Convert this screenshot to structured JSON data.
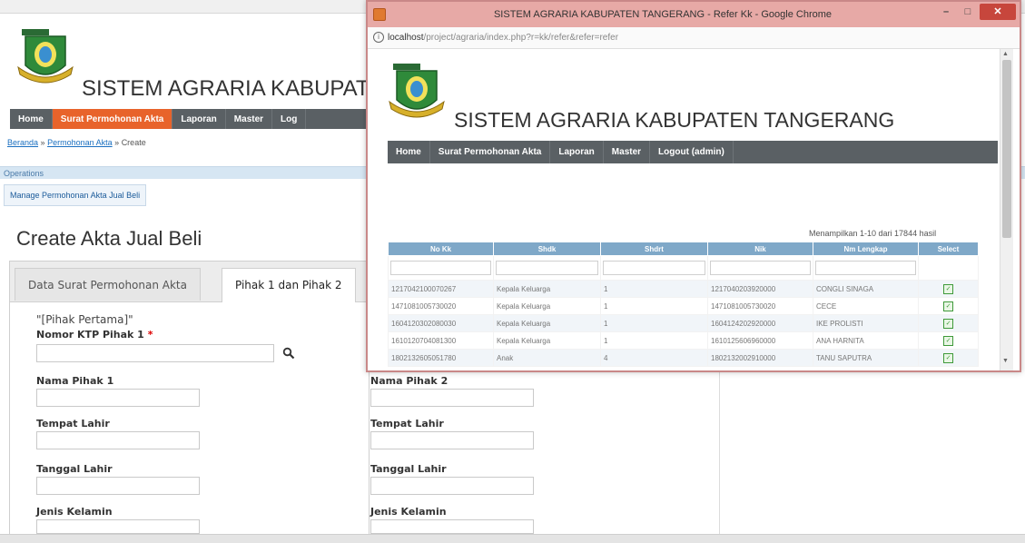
{
  "main": {
    "site_title": "SISTEM AGRARIA KABUPAT",
    "nav": [
      "Home",
      "Surat Permohonan Akta",
      "Laporan",
      "Master",
      "Log"
    ],
    "breadcrumb": {
      "home": "Beranda",
      "sep1": "»",
      "parent": "Permohonan Akta",
      "sep2": "»",
      "current": "Create"
    },
    "operations_label": "Operations",
    "manage_link": "Manage Permohonan Akta Jual Beli",
    "heading": "Create Akta Jual Beli",
    "tabs": [
      "Data Surat Permohonan Akta",
      "Pihak 1 dan Pihak 2"
    ],
    "form": {
      "pihak_pertama_note": "\"[Pihak Pertama]\"",
      "nomor_ktp_label": "Nomor KTP Pihak 1",
      "required_mark": "*",
      "nama_pihak_1": "Nama Pihak 1",
      "nama_pihak_2": "Nama Pihak 2",
      "tempat_lahir_1": "Tempat Lahir",
      "tempat_lahir_2": "Tempat Lahir",
      "tanggal_lahir_1": "Tanggal Lahir",
      "tanggal_lahir_2": "Tanggal Lahir",
      "jenis_kelamin_1": "Jenis Kelamin",
      "jenis_kelamin_2": "Jenis Kelamin"
    }
  },
  "popup": {
    "window_title": "SISTEM AGRARIA KABUPATEN TANGERANG - Refer Kk - Google Chrome",
    "window_controls": {
      "minimize": "–",
      "maximize": "□",
      "close": "✕"
    },
    "address": {
      "host": "localhost",
      "path": "/project/agraria/index.php?r=kk/refer&refer=refer"
    },
    "site_title": "SISTEM AGRARIA KABUPATEN TANGERANG",
    "nav": [
      "Home",
      "Surat Permohonan Akta",
      "Laporan",
      "Master",
      "Logout (admin)"
    ],
    "summary": "Menampilkan 1-10 dari 17844 hasil",
    "columns": [
      "No Kk",
      "Shdk",
      "Shdrt",
      "Nik",
      "Nm Lengkap",
      "Select"
    ],
    "rows": [
      [
        "1217042100070267",
        "Kepala Keluarga",
        "1",
        "1217040203920000",
        "CONGLI SINAGA"
      ],
      [
        "1471081005730020",
        "Kepala Keluarga",
        "1",
        "1471081005730020",
        "CECE"
      ],
      [
        "1604120302080030",
        "Kepala Keluarga",
        "1",
        "1604124202920000",
        "IKE PROLISTI"
      ],
      [
        "1610120704081300",
        "Kepala Keluarga",
        "1",
        "1610125606960000",
        "ANA HARNITA"
      ],
      [
        "1802132605051780",
        "Anak",
        "4",
        "1802132002910000",
        "TANU SAPUTRA"
      ]
    ],
    "select_icon": "check-icon"
  },
  "colors": {
    "nav_bg": "#5a6064",
    "nav_active": "#e8632b",
    "grid_header": "#7fa8c8",
    "popup_titlebar": "#e7a9a6"
  }
}
